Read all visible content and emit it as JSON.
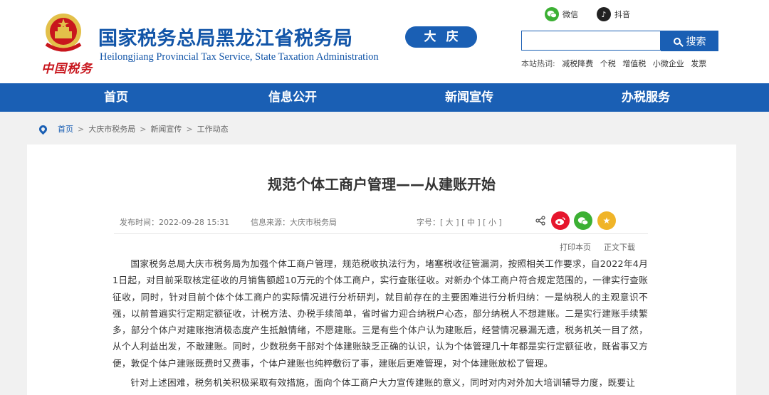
{
  "header": {
    "title_cn": "国家税务总局黑龙江省税务局",
    "title_en": "Heilongjiang Provincial Tax Service, State Taxation Administration",
    "city": "大庆",
    "brand_script": "中国税务"
  },
  "social": {
    "wechat_label": "微信",
    "douyin_label": "抖音"
  },
  "search": {
    "placeholder": "",
    "button_label": "搜索",
    "hot_label": "本站热词:",
    "hot_words": [
      "减税降费",
      "个税",
      "增值税",
      "小微企业",
      "发票"
    ]
  },
  "nav": {
    "items": [
      "首页",
      "信息公开",
      "新闻宣传",
      "办税服务"
    ]
  },
  "breadcrumb": {
    "items": [
      "首页",
      "大庆市税务局",
      "新闻宣传",
      "工作动态"
    ],
    "separator": ">"
  },
  "article": {
    "title": "规范个体工商户管理——从建账开始",
    "publish_time": "发布时间：2022-09-28 15:31",
    "source": "信息来源：大庆市税务局",
    "font_size_label": "字号：[ 大 ] [ 中 ] [ 小 ]",
    "print_label": "打印本页",
    "download_label": "正文下载",
    "paragraphs": [
      "国家税务总局大庆市税务局为加强个体工商户管理，规范税收执法行为，堵塞税收征管漏洞，按照相关工作要求，自2022年4月1日起，对目前采取核定征收的月销售额超10万元的个体工商户，实行查账征收。对新办个体工商户符合规定范围的，一律实行查账征收，同时，针对目前个体个体工商户的实际情况进行分析研判，就目前存在的主要困难进行分析归纳：一是纳税人的主观意识不强，以前普遍实行定期定额征收，计税方法、办税手续简单，省时省力迎合纳税户心态，部分纳税人不想建账。二是实行建账手续繁多，部分个体户对建账抱消极态度产生抵触情绪，不愿建账。三是有些个体户认为建账后，经营情况暴漏无遗，税务机关一目了然，从个人利益出发，不敢建账。同时，少数税务干部对个体建账缺乏正确的认识，认为个体管理几十年都是实行定额征收，既省事又方便，敦促个体户建账既费时又费事，个体户建账也纯粹敷衍了事，建账后更难管理，对个体建账放松了管理。",
      "针对上述困难，税务机关积极采取有效措施，面向个体工商户大力宣传建账的意义，同时对内对外加大培训辅导力度，既要让"
    ]
  },
  "colors": {
    "primary": "#1a5fb4",
    "brand_red": "#c8161d",
    "wechat": "#3cb034",
    "weibo": "#e6162d",
    "favorite": "#f0b428"
  }
}
